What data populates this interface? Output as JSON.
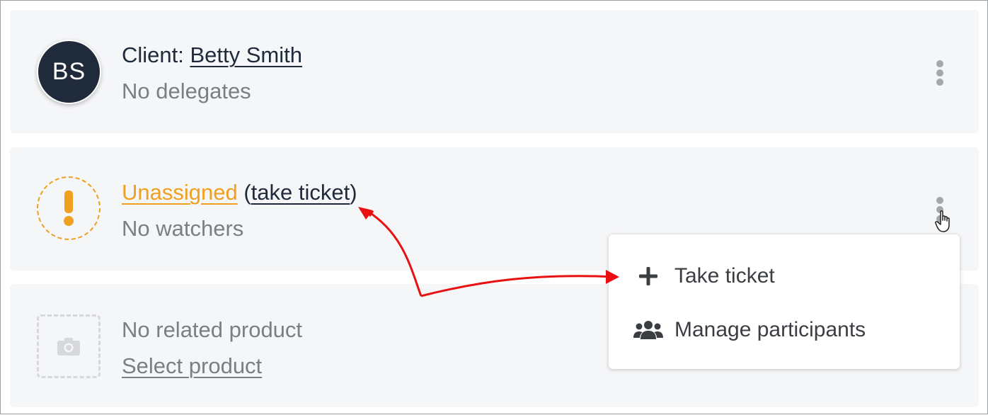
{
  "client": {
    "avatar_initials": "BS",
    "prefix": "Client: ",
    "name": "Betty Smith",
    "delegates": "No delegates"
  },
  "assignment": {
    "status": "Unassigned",
    "open_paren": " (",
    "take_link": "take ticket",
    "close_paren": ")",
    "watchers": "No watchers"
  },
  "product": {
    "status": "No related product",
    "select_link": "Select product"
  },
  "menu": {
    "items": [
      {
        "label": "Take ticket",
        "icon": "plus-icon"
      },
      {
        "label": "Manage participants",
        "icon": "users-icon"
      }
    ]
  },
  "colors": {
    "accent_orange": "#f0a020",
    "avatar_bg": "#1f2a3a",
    "annotation_arrow": "#e81010"
  }
}
